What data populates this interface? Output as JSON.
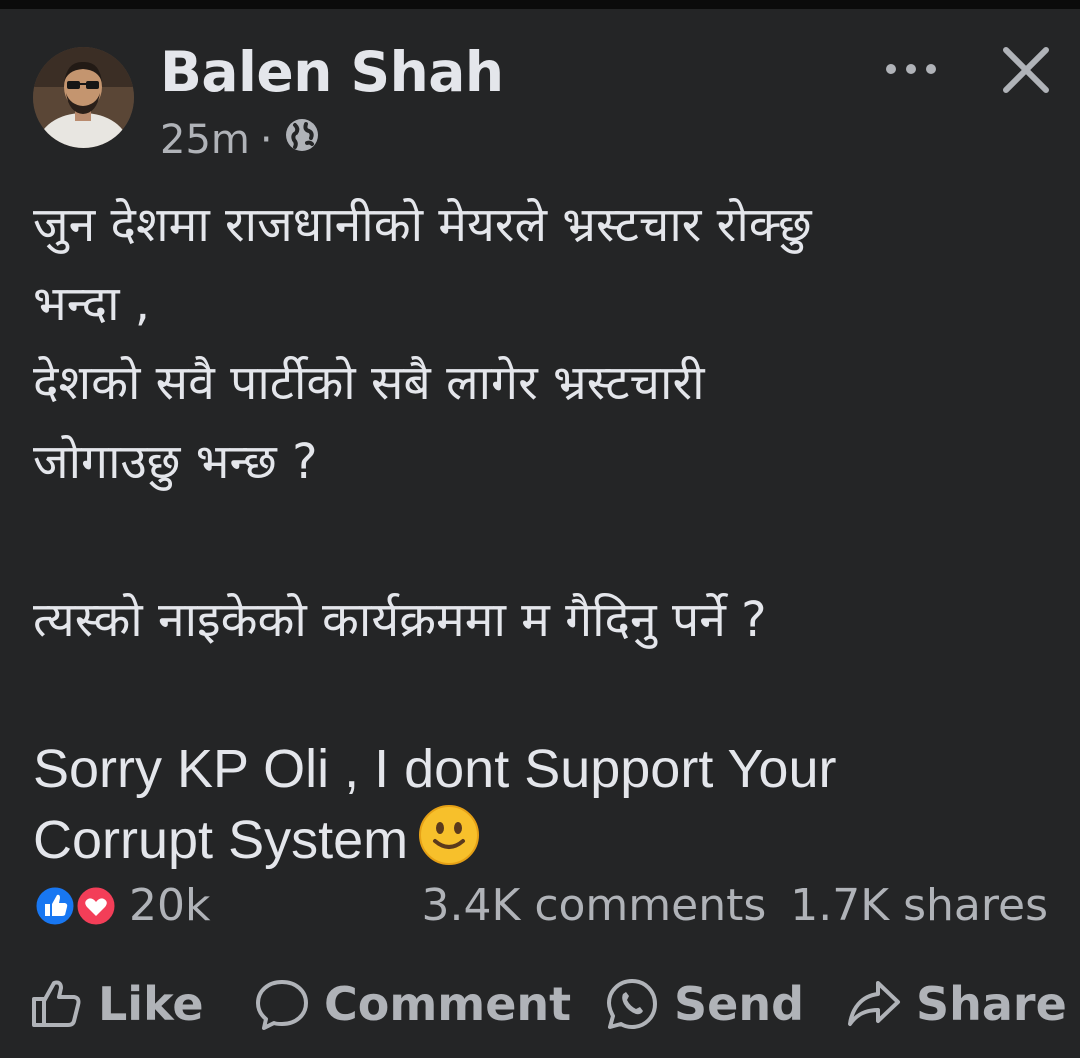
{
  "post": {
    "author": "Balen Shah",
    "time": "25m",
    "separator": "·",
    "visibility_icon": "globe-icon",
    "text_lines": [
      "जुन देशमा राजधानीको मेयरले भ्रस्टचार रोक्छु",
      "भन्दा ,",
      "देशको सवै पार्टीको सबै लागेर भ्रस्टचारी",
      "जोगाउछु भन्छ ?",
      "",
      "त्यस्को नाइकेको कार्यक्रममा म गैदिनु पर्ने ?",
      ""
    ],
    "english_line_1": "Sorry KP Oli , I dont Support Your",
    "english_line_2": "Corrupt System",
    "emoji": "slightly-smiling-face-emoji"
  },
  "stats": {
    "reactions": "20k",
    "comments": "3.4K comments",
    "shares": "1.7K shares"
  },
  "actions": {
    "like": "Like",
    "comment": "Comment",
    "send": "Send",
    "share": "Share"
  },
  "colors": {
    "background": "#242526",
    "text": "#e4e6eb",
    "secondary": "#b0b3b8",
    "like_blue": "#1877f2",
    "love_red": "#f33e58"
  }
}
